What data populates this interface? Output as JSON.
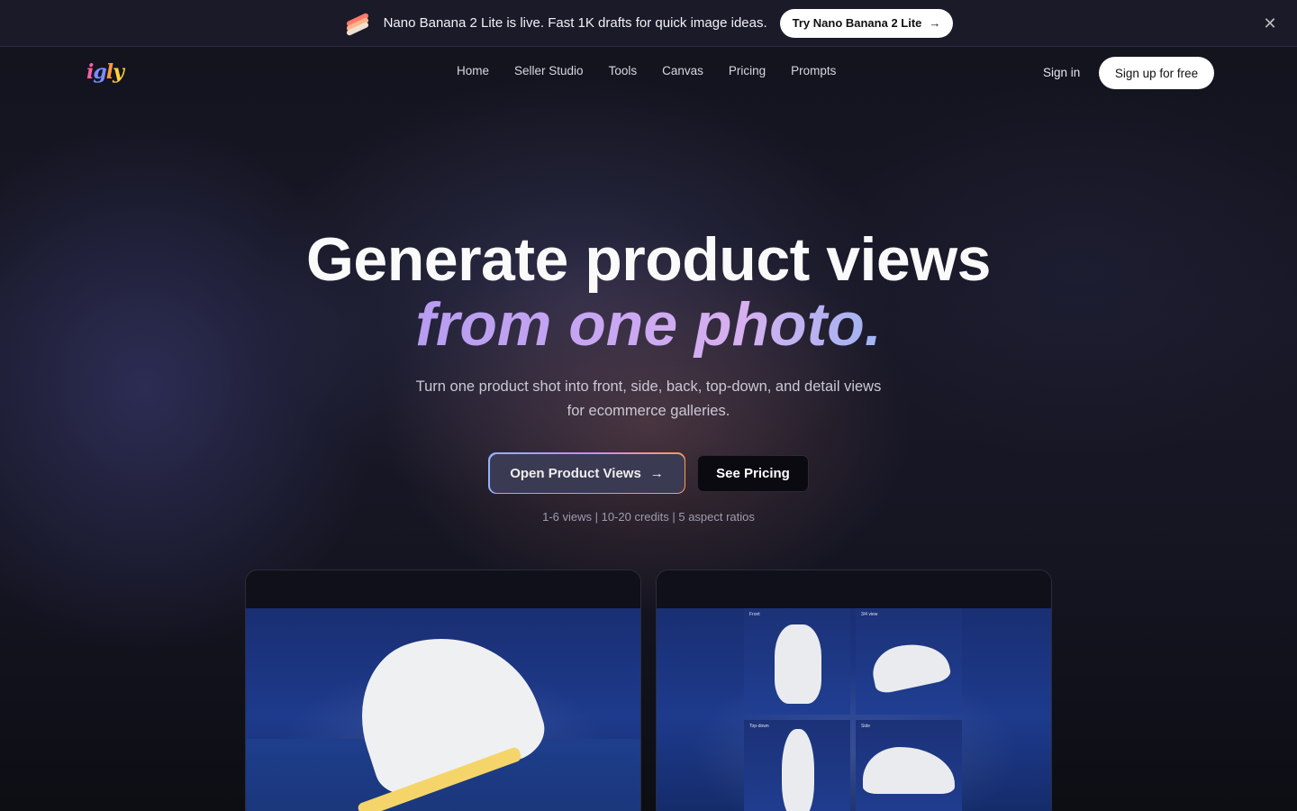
{
  "announcement": {
    "text": "Nano Banana 2 Lite is live. Fast 1K drafts for quick image ideas.",
    "button_label": "Try Nano Banana 2 Lite",
    "button_arrow": "→",
    "close_glyph": "✕"
  },
  "header": {
    "logo": {
      "c1": "i",
      "c2": "g",
      "c3": "l",
      "c4": "y"
    },
    "nav": [
      "Home",
      "Seller Studio",
      "Tools",
      "Canvas",
      "Pricing",
      "Prompts"
    ],
    "signin_label": "Sign in",
    "signup_label": "Sign up for free"
  },
  "hero": {
    "title_line1": "Generate product views",
    "title_line2": "from one photo.",
    "subtitle_line1": "Turn one product shot into front, side, back, top-down, and detail views",
    "subtitle_line2": "for ecommerce galleries.",
    "primary_cta": "Open Product Views",
    "primary_cta_arrow": "→",
    "secondary_cta": "See Pricing",
    "stats": "1-6 views | 10-20 credits | 5 aspect ratios"
  },
  "preview": {
    "tiles": [
      "Front",
      "3/4 view",
      "Top-down",
      "Side"
    ]
  },
  "colors": {
    "accent_gradient_start": "#8fb3ff",
    "accent_gradient_mid": "#c28cff",
    "accent_gradient_end": "#ff9a5a",
    "title_gradient": "#b79cf0"
  }
}
